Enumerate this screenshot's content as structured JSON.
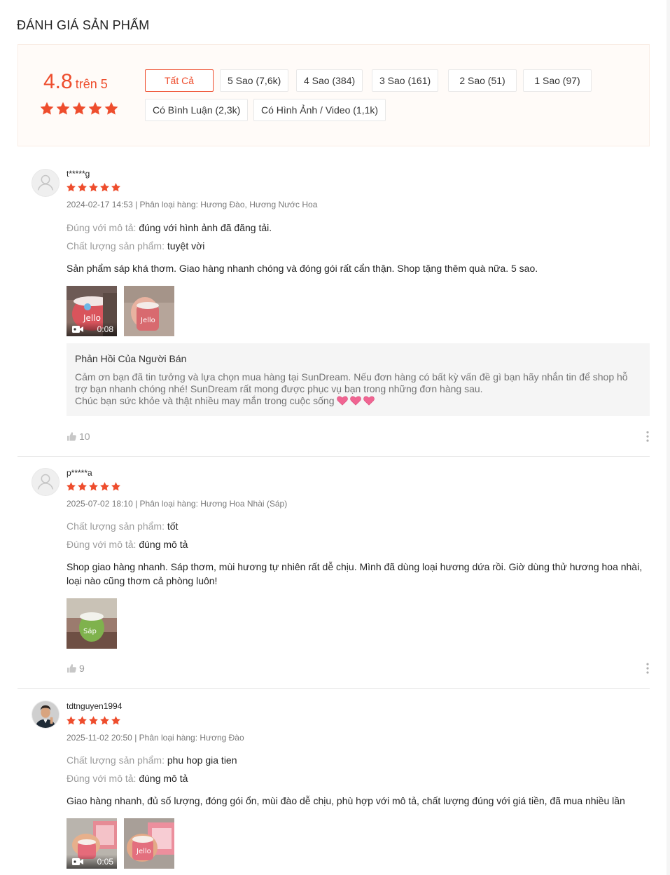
{
  "section": {
    "title": "ĐÁNH GIÁ SẢN PHẨM"
  },
  "overview": {
    "rating": "4.8",
    "rating_suffix": "trên 5",
    "star_count": 5,
    "filters": [
      "Tất Cả",
      "5 Sao (7,6k)",
      "4 Sao (384)",
      "3 Sao (161)",
      "2 Sao (51)",
      "1 Sao (97)",
      "Có Bình Luận (2,3k)",
      "Có Hình Ảnh / Video (1,1k)"
    ],
    "active_filter": "Tất Cả"
  },
  "colors": {
    "accent": "#ee4d2d",
    "overview_bg": "#fffbf8",
    "heart": "#f06592"
  },
  "reviews": [
    {
      "username": "t*****g",
      "stars": 5,
      "meta": "2024-02-17 14:53 | Phân loại hàng: Hương Đào, Hương Nước Hoa",
      "attributes": [
        {
          "key": "Đúng với mô tả:",
          "value": "đúng với hình ảnh đã đăng tải."
        },
        {
          "key": "Chất lượng sản phẩm:",
          "value": "tuyệt vời"
        }
      ],
      "content": "Sản phẩm sáp khá thơm. Giao hàng nhanh chóng và đóng gói rất cẩn thận. Shop tặng thêm quà nữa. 5 sao.",
      "media": [
        {
          "kind": "video",
          "duration": "0:08",
          "icon": "video-camera-icon"
        },
        {
          "kind": "image"
        }
      ],
      "seller_reply": {
        "title": "Phản Hồi Của Người Bán",
        "lines": [
          "Cảm ơn bạn đã tin tưởng và lựa chọn mua hàng tại SunDream. Nếu đơn hàng có bất kỳ vấn đề gì bạn hãy nhắn tin để shop hỗ",
          "trợ bạn nhanh chóng nhé! SunDream rất mong được phục vụ bạn trong những đơn hàng sau.",
          "Chúc bạn sức khỏe và thật nhiều may mắn trong cuộc sống"
        ],
        "emoji_icon": "pink-heart-icon"
      },
      "likes": "10"
    },
    {
      "username": "p*****a",
      "stars": 5,
      "meta": "2025-07-02 18:10 | Phân loại hàng: Hương Hoa Nhài (Sáp)",
      "attributes": [
        {
          "key": "Chất lượng sản phẩm:",
          "value": "tốt"
        },
        {
          "key": "Đúng với mô tả:",
          "value": "đúng mô tả"
        }
      ],
      "content": "Shop giao hàng nhanh. Sáp thơm, mùi hương tự nhiên rất dễ chịu. Mình đã dùng loại hương dứa rồi. Giờ dùng thử hương hoa nhài, loại nào cũng thơm cả phòng luôn!",
      "media": [
        {
          "kind": "image"
        }
      ],
      "likes": "9"
    },
    {
      "username": "tdtnguyen1994",
      "stars": 5,
      "meta": "2025-11-02 20:50 | Phân loại hàng: Hương Đào",
      "attributes": [
        {
          "key": "Chất lượng sản phẩm:",
          "value": "phu hop gia tien"
        },
        {
          "key": "Đúng với mô tả:",
          "value": "đúng mô tả"
        }
      ],
      "content": "Giao hàng nhanh, đủ số lượng, đóng gói ổn, mùi đào dễ chịu, phù hợp với mô tả, chất lượng đúng với giá tiền, đã mua nhiều lần",
      "media": [
        {
          "kind": "video",
          "duration": "0:05",
          "icon": "video-camera-icon"
        },
        {
          "kind": "image"
        }
      ]
    }
  ]
}
